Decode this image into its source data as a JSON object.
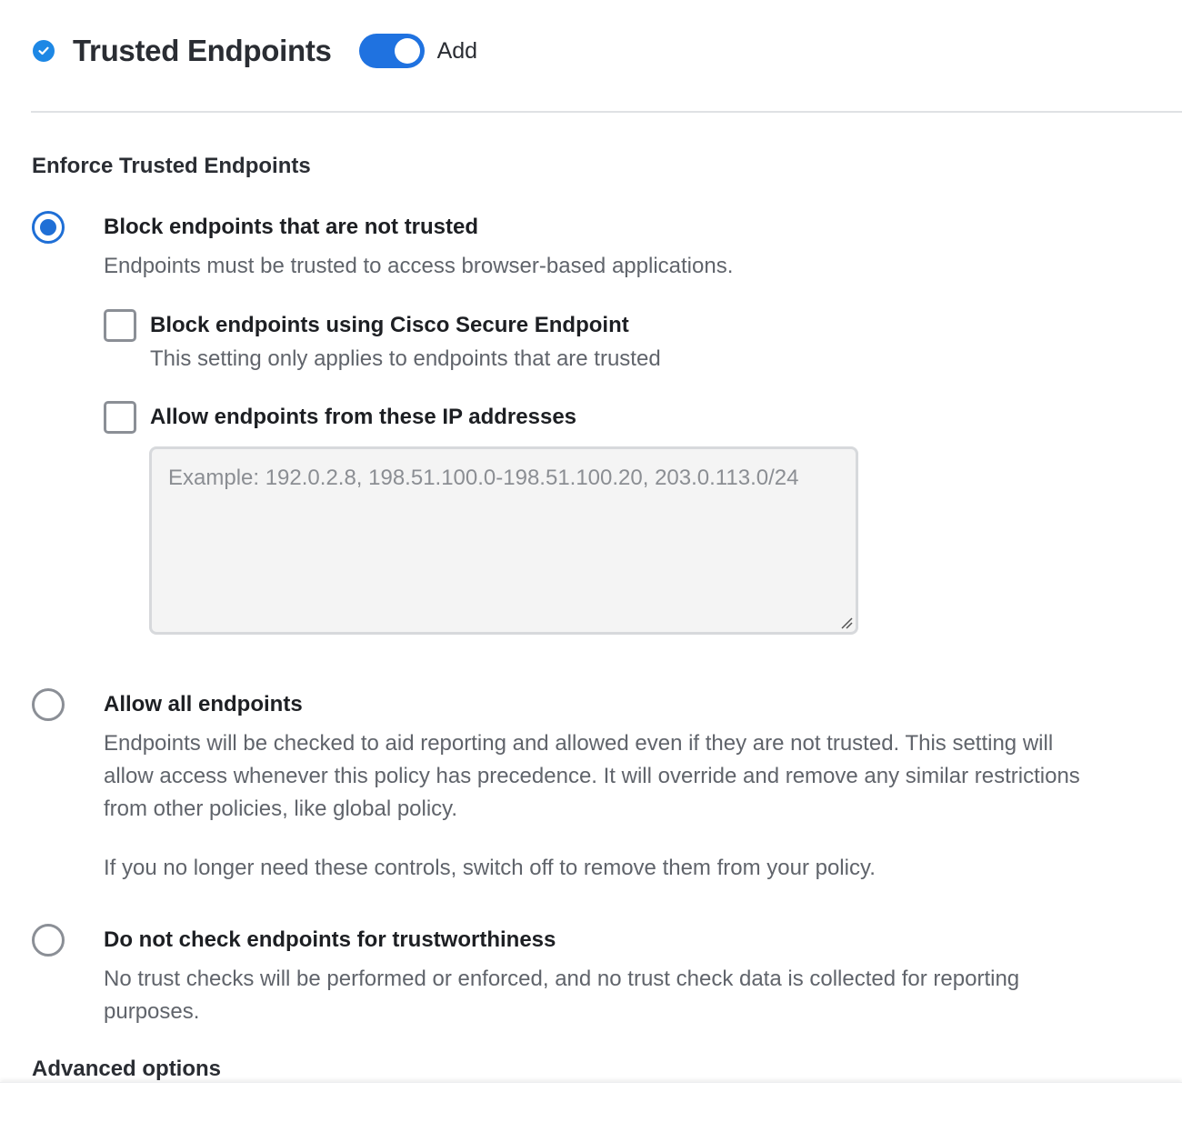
{
  "header": {
    "title": "Trusted Endpoints",
    "toggle_on": true,
    "toggle_label": "Add",
    "colors": {
      "check_badge": "#1e88e5",
      "toggle": "#1f72e0"
    }
  },
  "section": {
    "title": "Enforce Trusted Endpoints"
  },
  "options": [
    {
      "selected": true,
      "title": "Block endpoints that are not trusted",
      "description": "Endpoints must be trusted to access browser-based applications.",
      "sub_options": [
        {
          "checked": false,
          "title": "Block endpoints using Cisco Secure Endpoint",
          "description": "This setting only applies to endpoints that are trusted"
        },
        {
          "checked": false,
          "title": "Allow endpoints from these IP addresses",
          "input_value": "",
          "input_placeholder": "Example: 192.0.2.8, 198.51.100.0-198.51.100.20, 203.0.113.0/24"
        }
      ]
    },
    {
      "selected": false,
      "title": "Allow all endpoints",
      "description": "Endpoints will be checked to aid reporting and allowed even if they are not trusted. This setting will allow access whenever this policy has precedence. It will override and remove any similar restrictions from other policies, like global policy.",
      "note": "If you no longer need these controls, switch off to remove them from your policy."
    },
    {
      "selected": false,
      "title": "Do not check endpoints for trustworthiness",
      "description": "No trust checks will be performed or enforced, and no trust check data is collected for reporting purposes."
    }
  ],
  "advanced_title": "Advanced options",
  "accent_color": "#1f6fd6"
}
